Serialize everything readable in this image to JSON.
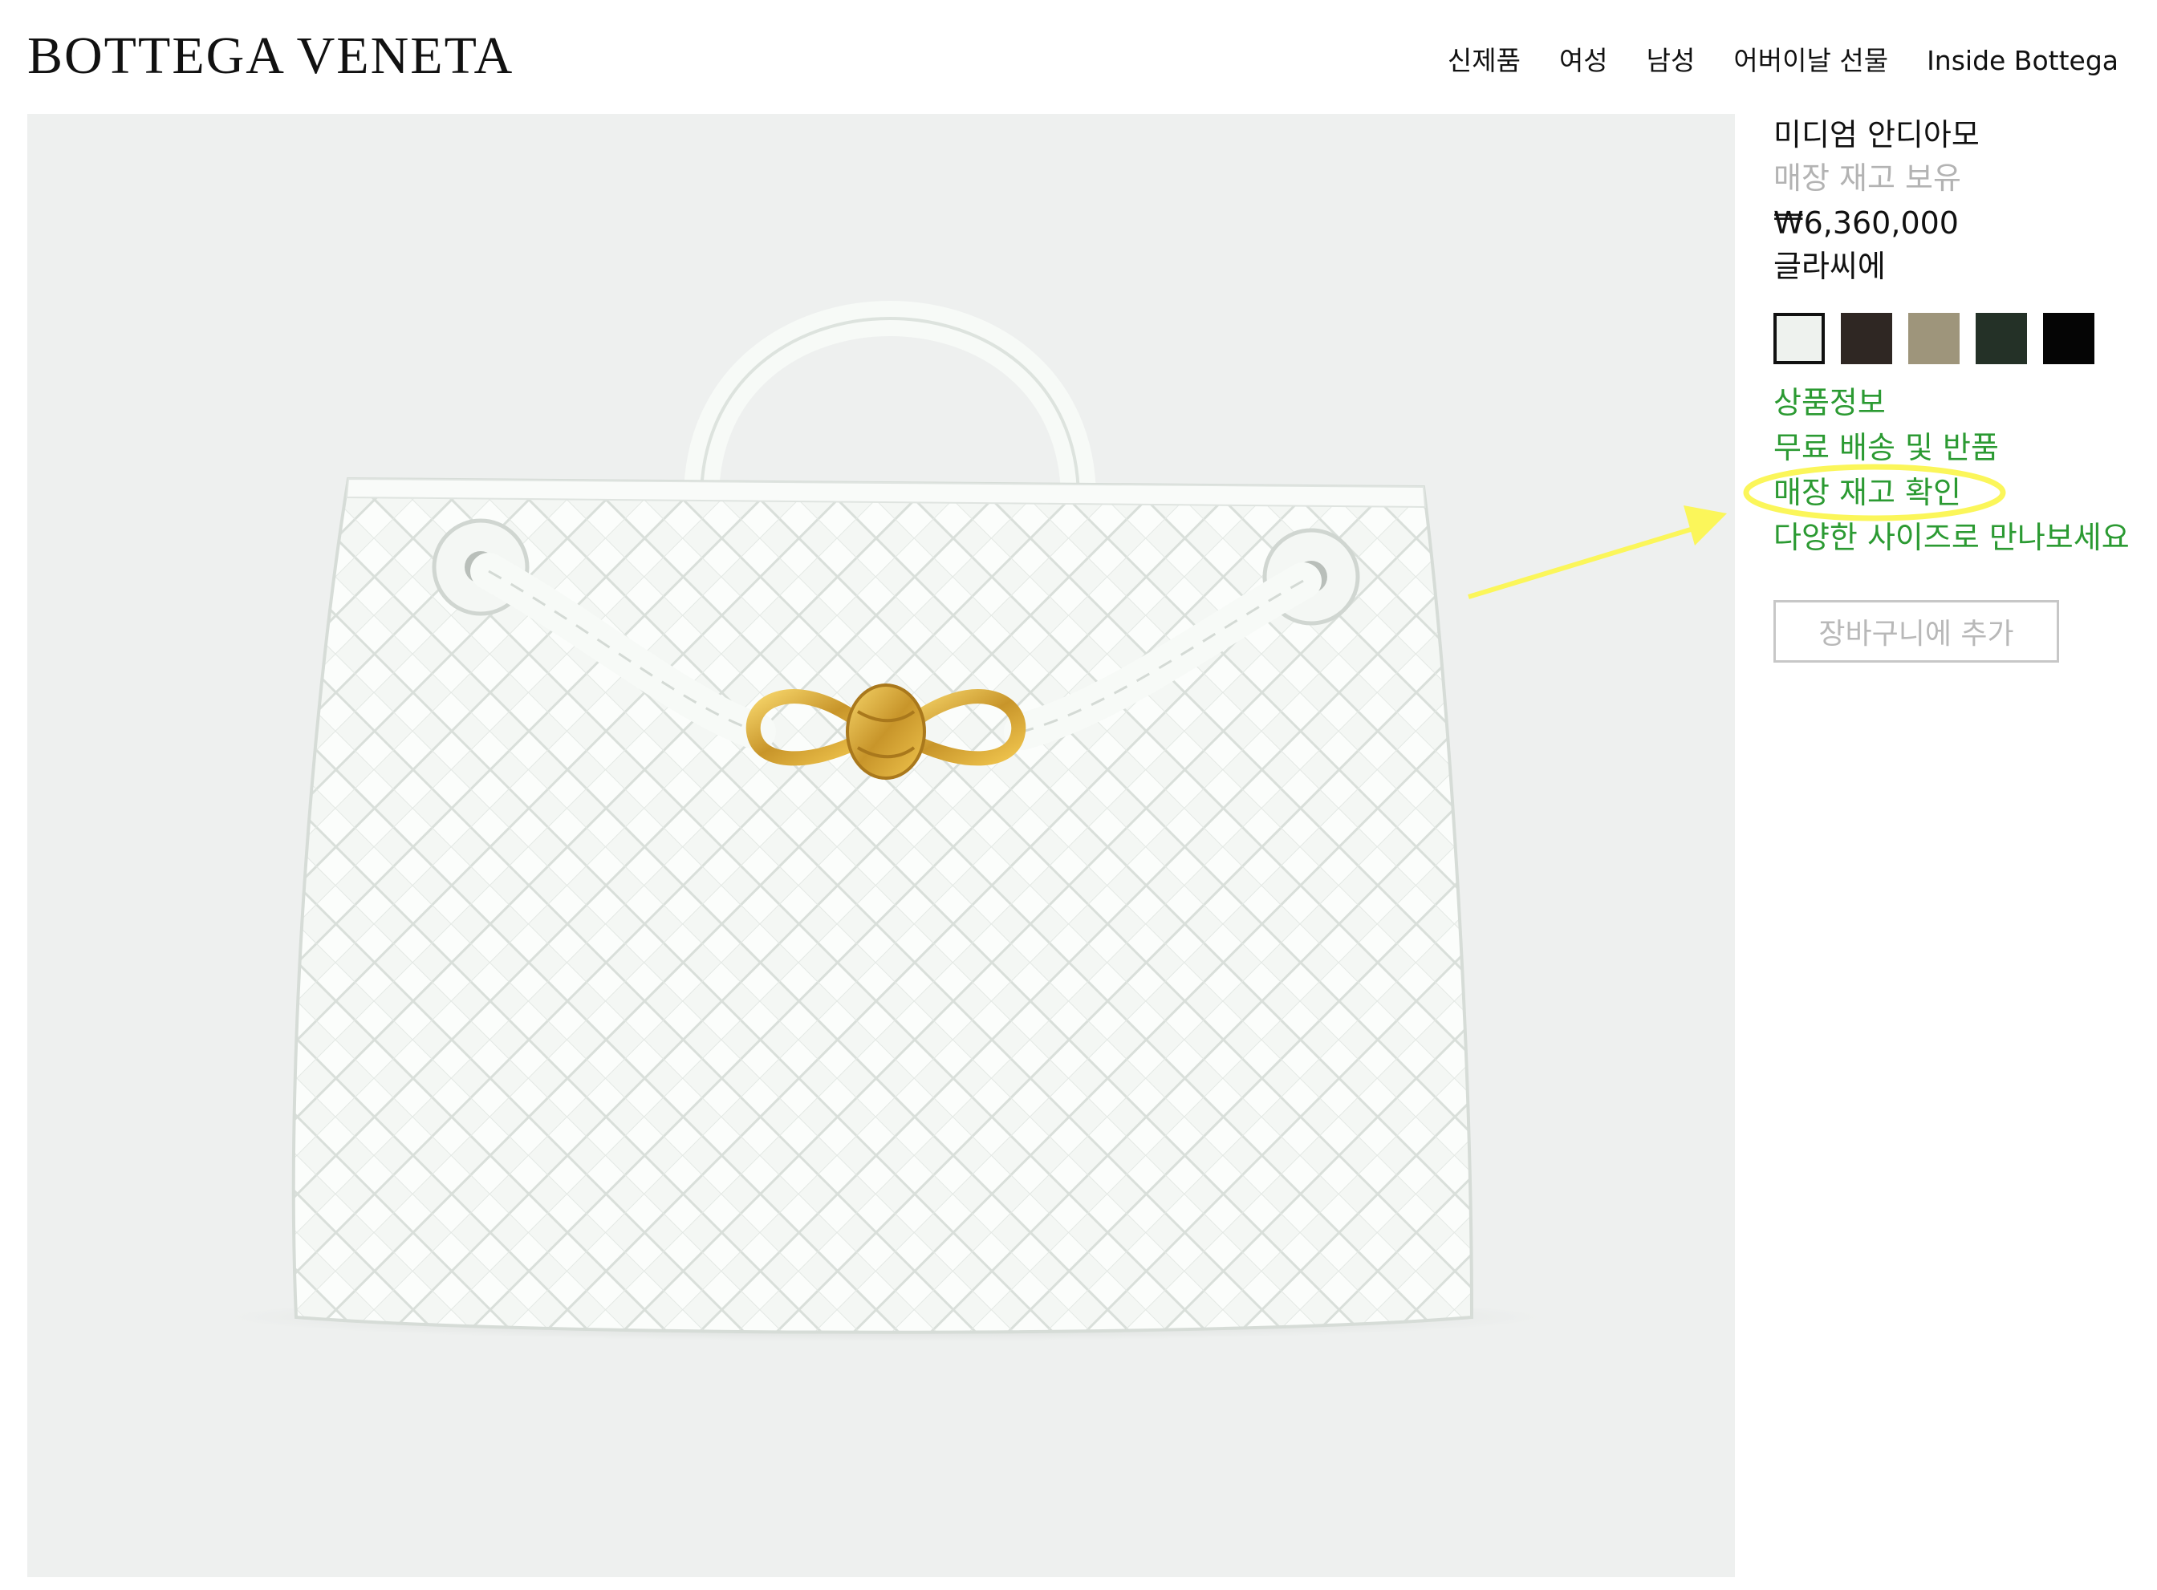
{
  "header": {
    "logo": "BOTTEGA VENETA",
    "nav": [
      "신제품",
      "여성",
      "남성",
      "어버이날 선물",
      "Inside Bottega"
    ]
  },
  "product": {
    "name": "미디엄 안디아모",
    "stock_note": "매장 재고 보유",
    "price": "₩6,360,000",
    "color_name": "글라씨에",
    "swatches": [
      "#eef2ee",
      "#2f2723",
      "#9e957b",
      "#243127",
      "#050505"
    ],
    "selected_swatch": 0,
    "links": [
      "상품정보",
      "무료 배송 및 반품",
      "매장 재고 확인",
      "다양한 사이즈로 만나보세요"
    ],
    "add_to_cart": "장바구니에 추가"
  },
  "colors": {
    "link": "#2b9a32",
    "annotation": "#fbf65a",
    "image_background": "#eef0ef"
  },
  "image": {
    "icon": "product-image-woven-handbag"
  }
}
